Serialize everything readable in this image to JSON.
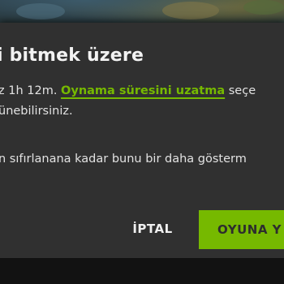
{
  "dialog": {
    "title": "i bitmek üzere",
    "line1_before": "z 1h 12m. ",
    "line1_link": "Oynama süresini uzatma",
    "line1_after": " seçe",
    "line2": "ünebilirsiniz.",
    "line3": "n sıfırlanana kadar bunu bir daha gösterm"
  },
  "buttons": {
    "cancel_label": "İPTAL",
    "play_label": "OYUNA Y"
  },
  "colors": {
    "accent": "#76b900",
    "dialog_bg": "#303030",
    "page_bg": "#121212"
  }
}
